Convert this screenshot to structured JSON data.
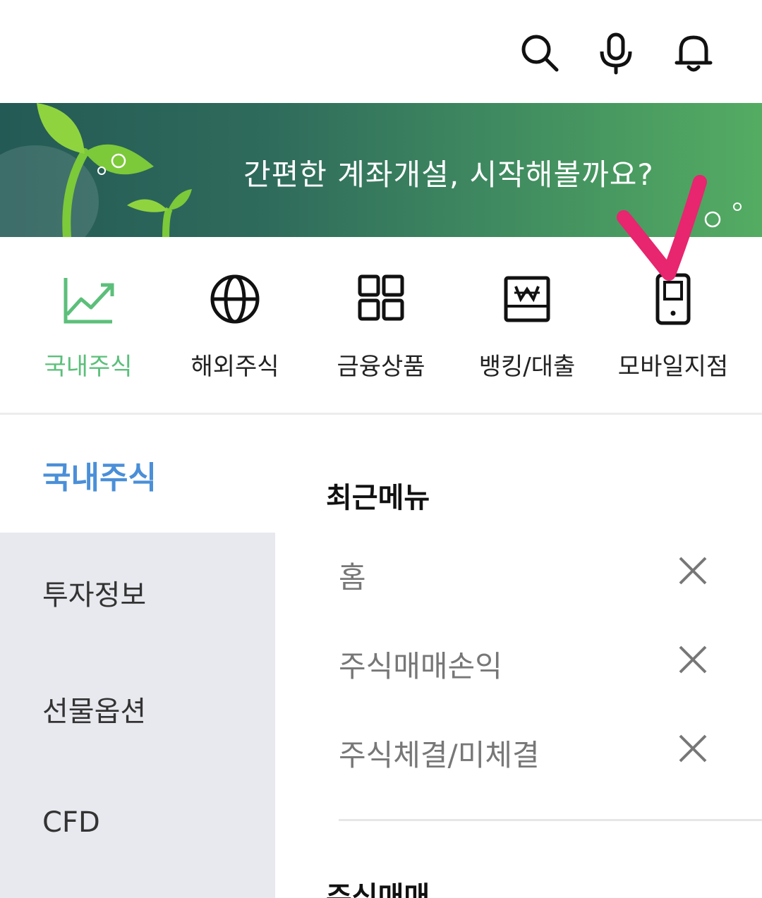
{
  "header": {
    "icons": [
      "search-icon",
      "microphone-icon",
      "bell-icon"
    ]
  },
  "banner": {
    "text": "간편한 계좌개설, 시작해볼까요?"
  },
  "quick_menu": {
    "items": [
      {
        "label": "국내주식",
        "icon": "chart-line-icon",
        "active": true
      },
      {
        "label": "해외주식",
        "icon": "globe-icon",
        "active": false
      },
      {
        "label": "금융상품",
        "icon": "grid-icon",
        "active": false
      },
      {
        "label": "뱅킹/대출",
        "icon": "won-bill-icon",
        "active": false
      },
      {
        "label": "모바일지점",
        "icon": "mobile-icon",
        "active": false
      }
    ]
  },
  "sidebar": {
    "active": "국내주식",
    "items": [
      "투자정보",
      "선물옵션",
      "CFD"
    ]
  },
  "content": {
    "recent_title": "최근메뉴",
    "recent_items": [
      "홈",
      "주식매매손익",
      "주식체결/미체결"
    ],
    "next_section_title": "주식매매"
  },
  "colors": {
    "active_green": "#5bbf7a",
    "active_blue": "#4a8fd8",
    "sidebar_bg": "#e8e9ee",
    "annotation_pink": "#e8256f"
  }
}
